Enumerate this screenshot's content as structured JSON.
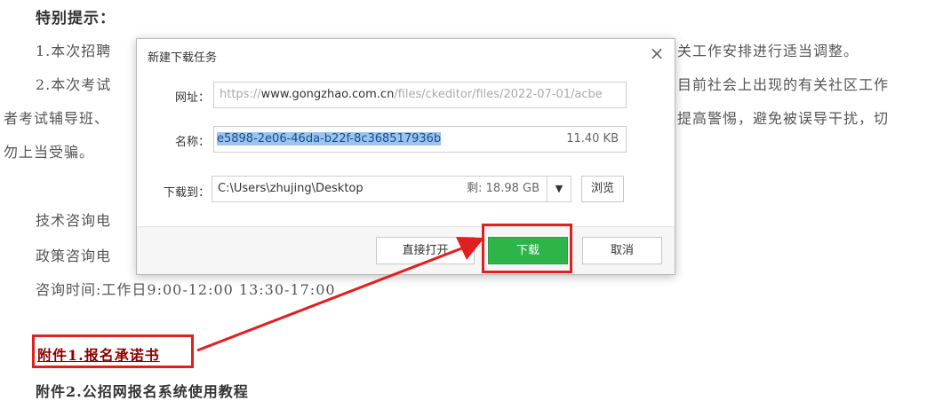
{
  "background_text": {
    "heading": "特别提示：",
    "line1_left": "1.本次招聘",
    "line1_right": "关工作安排进行适当调整。",
    "line2_left": "2.本次考试",
    "line2_right": "目前社会上出现的有关社区工作",
    "line3_left": "者考试辅导班、",
    "line3_right": "提高警惕，避免被误导干扰，切",
    "line4": "勿上当受骗。",
    "tech_phone": "技术咨询电",
    "policy_phone": "政策咨询电",
    "hours": "咨询时间:工作日9:00-12:00  13:30-17:00",
    "attachment1": "附件1.报名承诺书",
    "attachment2": "附件2.公招网报名系统使用教程"
  },
  "dialog": {
    "title": "新建下载任务",
    "url_label": "网址：",
    "url_prefix": "https://",
    "url_domain": "www.gongzhao.com.cn",
    "url_path": "/files/ckeditor/files/2022-07-01/acbe",
    "name_label": "名称：",
    "file_name": "e5898-2e06-46da-b22f-8c368517936b",
    "file_size": "11.40 KB",
    "save_to_label": "下载到：",
    "save_path": "C:\\Users\\zhujing\\Desktop",
    "free_space": "剩: 18.98 GB",
    "browse_label": "浏览",
    "open_direct_label": "直接打开",
    "download_label": "下载",
    "cancel_label": "取消"
  },
  "colors": {
    "accent_green": "#2fb44a",
    "annotation_red": "#e02020",
    "selection_blue": "#9cc4f0"
  }
}
